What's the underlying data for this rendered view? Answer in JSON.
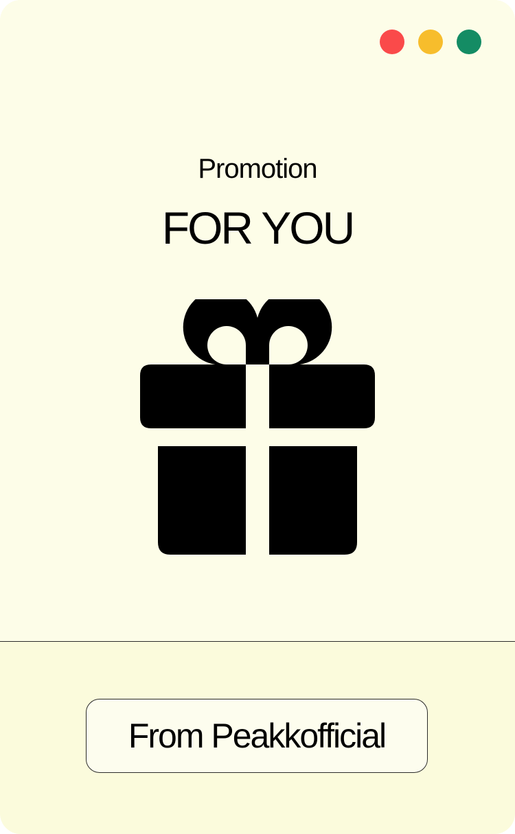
{
  "window_controls": {
    "close": {
      "icon": "close-dot-icon",
      "color": "#fa4a4a"
    },
    "minimize": {
      "icon": "minimize-dot-icon",
      "color": "#f7bd2c"
    },
    "maximize": {
      "icon": "maximize-dot-icon",
      "color": "#148c64"
    }
  },
  "header": {
    "subtitle": "Promotion",
    "title": "FOR YOU"
  },
  "illustration": {
    "icon": "gift-icon"
  },
  "footer": {
    "button_label": "From Peakkofficial"
  },
  "colors": {
    "background": "#fdfde8",
    "footer_background": "#fbfbdc",
    "ink": "#000000"
  }
}
